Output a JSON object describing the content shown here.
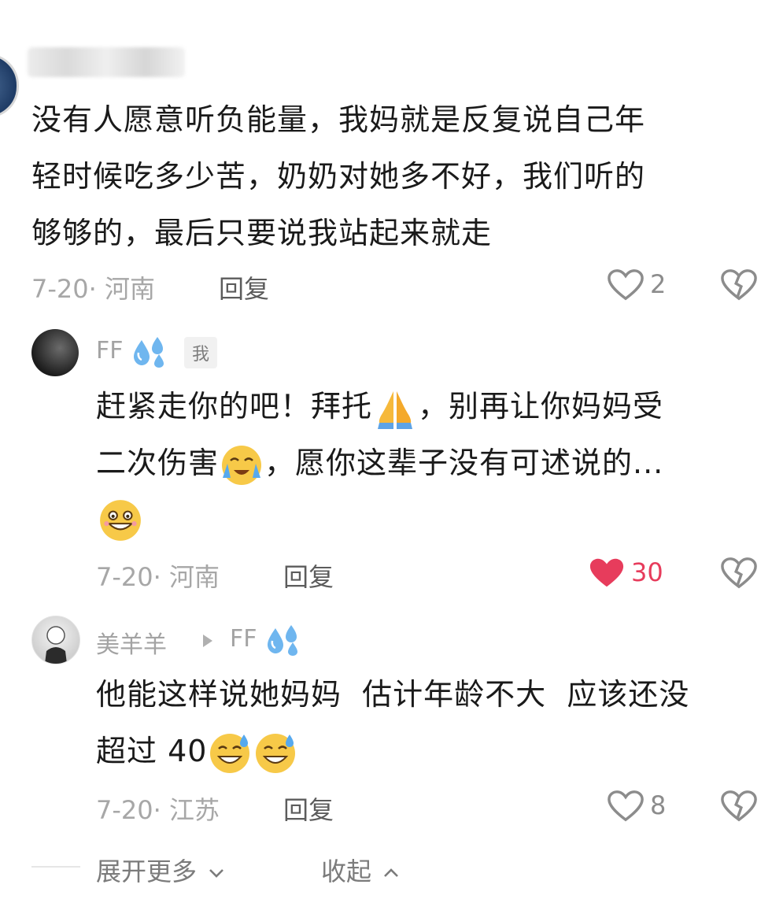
{
  "comment1": {
    "text_line1": "没有人愿意听负能量，我妈就是反复说自己年",
    "text_line2": "轻时候吃多少苦，奶奶对她多不好，我们听的",
    "text_line3": "够够的，最后只要说我站起来就走",
    "meta": "7-20· 河南",
    "reply_label": "回复",
    "like_count": "2"
  },
  "reply1": {
    "author": "FF",
    "tag": "我",
    "text_line1_a": "赶紧走你的吧！拜托",
    "text_line1_b": "，别再让你妈妈受",
    "text_line2_a": "二次伤害",
    "text_line2_b": "，愿你这辈子没有可述说的...",
    "meta": "7-20· 河南",
    "reply_label": "回复",
    "like_count": "30"
  },
  "reply2": {
    "author": "美羊羊",
    "reply_to": "FF",
    "text_line1": "他能这样说她妈妈  估计年龄不大  应该还没",
    "text_line2_a": "超过 40",
    "meta": "7-20· 江苏",
    "reply_label": "回复",
    "like_count": "8"
  },
  "footer": {
    "expand_more": "展开更多",
    "collapse": "收起"
  },
  "colors": {
    "liked": "#e73c5c",
    "meta": "#a7a7a7"
  }
}
